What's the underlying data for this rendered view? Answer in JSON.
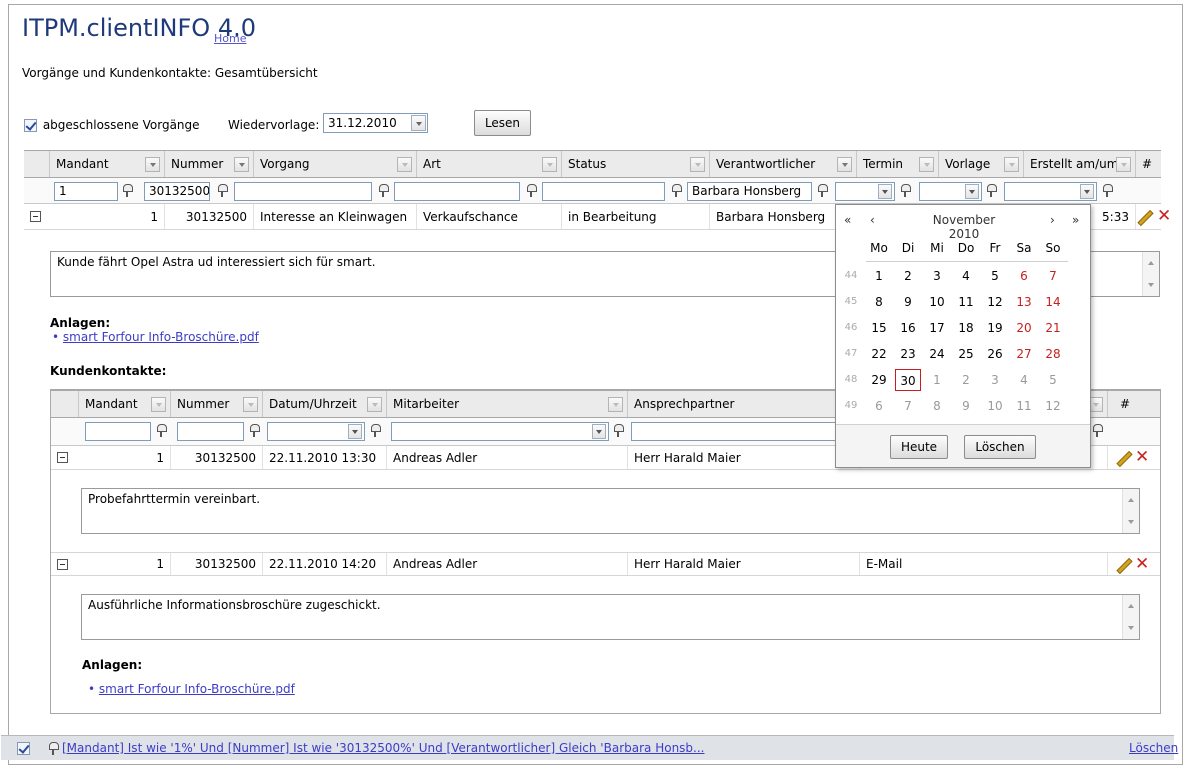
{
  "app": {
    "title": "ITPM.clientINFO 4.0",
    "home_link": "Home",
    "subtitle": "Vorgänge und Kundenkontakte: Gesamtübersicht"
  },
  "toolbar": {
    "closed_label": "abgeschlossene Vorgänge",
    "closed_checked": true,
    "wiedervorlage_label": "Wiedervorlage:",
    "wiedervorlage_value": "31.12.2010",
    "lesen_label": "Lesen"
  },
  "main_grid": {
    "headers": {
      "mandant": "Mandant",
      "nummer": "Nummer",
      "vorgang": "Vorgang",
      "art": "Art",
      "status": "Status",
      "verantwortlicher": "Verantwortlicher",
      "termin": "Termin",
      "vorlage": "Vorlage",
      "erstellt": "Erstellt am/um",
      "hash": "#"
    },
    "filters": {
      "mandant": "1",
      "nummer": "30132500",
      "vorgang": "",
      "art": "",
      "status": "",
      "verantwortlicher": "Barbara Honsberg",
      "termin": "",
      "vorlage": "",
      "erstellt": ""
    },
    "row": {
      "mandant": "1",
      "nummer": "30132500",
      "vorgang": "Interesse an Kleinwagen",
      "art": "Verkaufschance",
      "status": "in Bearbeitung",
      "verantwortlicher": "Barbara Honsberg",
      "erstellt_partial": "5:33"
    },
    "memo": "Kunde fährt Opel Astra ud interessiert sich für smart.",
    "anlagen_label": "Anlagen:",
    "anlage": "smart Forfour Info-Broschüre.pdf"
  },
  "contacts": {
    "label": "Kundenkontakte:",
    "headers": {
      "mandant": "Mandant",
      "nummer": "Nummer",
      "datum": "Datum/Uhrzeit",
      "mitarbeiter": "Mitarbeiter",
      "ansprechpartner": "Ansprechpartner",
      "hash": "#"
    },
    "rows": [
      {
        "mandant": "1",
        "nummer": "30132500",
        "datum": "22.11.2010 13:30",
        "mitarbeiter": "Andreas Adler",
        "ansprechpartner": "Herr Harald Maier",
        "art": "",
        "memo": "Probefahrttermin vereinbart."
      },
      {
        "mandant": "1",
        "nummer": "30132500",
        "datum": "22.11.2010 14:20",
        "mitarbeiter": "Andreas Adler",
        "ansprechpartner": "Herr Harald Maier",
        "art": "E-Mail",
        "memo": "Ausführliche Informationsbroschüre zugeschickt."
      }
    ],
    "anlagen_label": "Anlagen:",
    "anlage": "smart Forfour Info-Broschüre.pdf"
  },
  "calendar": {
    "nav_prev_year": "«",
    "nav_prev_month": "‹",
    "nav_next_month": "›",
    "nav_next_year": "»",
    "month_title": "November 2010",
    "weekdays": [
      "Mo",
      "Di",
      "Mi",
      "Do",
      "Fr",
      "Sa",
      "So"
    ],
    "weeks": [
      {
        "kw": "44",
        "days": [
          "1",
          "2",
          "3",
          "4",
          "5",
          "6",
          "7"
        ]
      },
      {
        "kw": "45",
        "days": [
          "8",
          "9",
          "10",
          "11",
          "12",
          "13",
          "14"
        ]
      },
      {
        "kw": "46",
        "days": [
          "15",
          "16",
          "17",
          "18",
          "19",
          "20",
          "21"
        ]
      },
      {
        "kw": "47",
        "days": [
          "22",
          "23",
          "24",
          "25",
          "26",
          "27",
          "28"
        ]
      },
      {
        "kw": "48",
        "days": [
          "29",
          "30",
          "1",
          "2",
          "3",
          "4",
          "5"
        ]
      },
      {
        "kw": "49",
        "days": [
          "6",
          "7",
          "8",
          "9",
          "10",
          "11",
          "12"
        ]
      }
    ],
    "selected_day": "30",
    "today_label": "Heute",
    "clear_label": "Löschen",
    "weekend_color": "#c81e1e"
  },
  "status_bar": {
    "filter_text": "[Mandant] Ist wie '1%' Und [Nummer] Ist wie '30132500%' Und [Verantwortlicher] Gleich 'Barbara Honsb...",
    "clear_label": "Löschen",
    "checked": true
  }
}
